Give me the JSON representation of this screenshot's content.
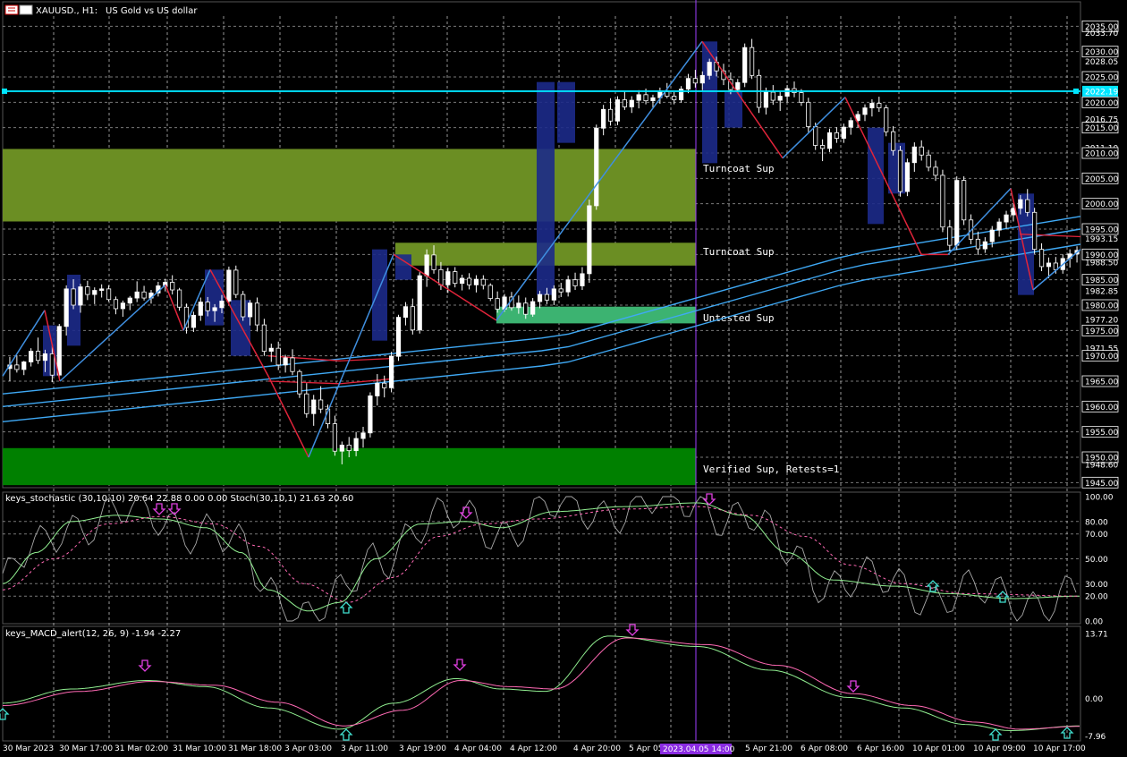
{
  "header": {
    "symbol": "XAUUSD., H1:",
    "description": "US Gold vs US dollar"
  },
  "colors": {
    "background": "#000000",
    "grid": "#c8c8c8",
    "bull_candle": "#ffffff",
    "bear_candle": "#000000",
    "ema_blue": "#3fa9f5",
    "ema_red": "#e0243a",
    "zigzag_up": "#3f8fe0",
    "zigzag_down": "#e0243a",
    "hline": "#00e5ff",
    "zone_turncoat": "#6b8e23",
    "zone_untested": "#3cb371",
    "zone_verified": "#008000",
    "signal_down": "#e040e0",
    "signal_up": "#40e0d0",
    "vline": "#a040ff",
    "stoch_main": "#a9a9a9",
    "stoch_signal": "#90ee90",
    "stoch_dash": "#ff69b4",
    "macd_main": "#90ee90",
    "macd_signal": "#ff69b4"
  },
  "price_axis": {
    "labels": [
      "2035.00",
      "2033.70",
      "2030.00",
      "2028.05",
      "2025.00",
      "2022.19",
      "2020.00",
      "2016.75",
      "2015.00",
      "2011.10",
      "2010.00",
      "2005.00",
      "2000.00",
      "1995.00",
      "1993.15",
      "1990.00",
      "1988.50",
      "1985.00",
      "1982.85",
      "1980.00",
      "1977.20",
      "1975.00",
      "1971.55",
      "1970.00",
      "1965.00",
      "1960.00",
      "1955.00",
      "1950.00",
      "1948.60",
      "1945.00"
    ],
    "current_price": "2022.19"
  },
  "zones": [
    {
      "label": "Turncoat Sup",
      "top": 2010.8,
      "bottom": 1996.5,
      "kind": "turncoat"
    },
    {
      "label": "Turncoat Sup",
      "top": 1992.3,
      "bottom": 1987.8,
      "kind": "turncoat"
    },
    {
      "label": "Untested Sup",
      "top": 1979.7,
      "bottom": 1976.4,
      "kind": "untested"
    },
    {
      "label": "Verified Sup, Retests=1",
      "top": 1951.8,
      "bottom": 1944.5,
      "kind": "verified"
    }
  ],
  "stochastic": {
    "title": "keys_stochastic (30,10,10) 20.64 22.88 0.00 0.00 Stoch(30,10,1) 21.63 20.60",
    "levels": [
      "100.00",
      "80.00",
      "70.00",
      "50.00",
      "30.00",
      "20.00",
      "0.00"
    ]
  },
  "macd": {
    "title": "keys_MACD_alert(12, 26, 9) -1.94 -2.27",
    "levels": [
      "13.71",
      "0.00",
      "-7.96"
    ]
  },
  "time_axis": {
    "labels": [
      "30 Mar 2023",
      "30 Mar 17:00",
      "31 Mar 02:00",
      "31 Mar 10:00",
      "31 Mar 18:00",
      "3 Apr 03:00",
      "3 Apr 11:00",
      "3 Apr 19:00",
      "4 Apr 04:00",
      "4 Apr 12:00",
      "4 Apr 20:00",
      "5 Apr 05:00",
      "5 Apr 21:00",
      "6 Apr 08:00",
      "6 Apr 16:00",
      "10 Apr 01:00",
      "10 Apr 09:00",
      "10 Apr 17:00"
    ],
    "cursor_label": "2023.04.05 14:00"
  },
  "chart_data": {
    "type": "candlestick",
    "title": "",
    "symbol": "XAUUSD.",
    "timeframe": "H1",
    "ylim": [
      1944,
      2037
    ],
    "candles": [
      [
        1967.5,
        1969.8,
        1965.0,
        1968.2
      ],
      [
        1968.2,
        1970.1,
        1966.7,
        1967.3
      ],
      [
        1967.3,
        1969.0,
        1966.2,
        1968.8
      ],
      [
        1968.8,
        1971.5,
        1967.9,
        1970.9
      ],
      [
        1970.9,
        1973.6,
        1968.4,
        1969.1
      ],
      [
        1969.1,
        1971.2,
        1966.8,
        1970.4
      ],
      [
        1970.4,
        1972.0,
        1964.8,
        1966.2
      ],
      [
        1966.2,
        1976.3,
        1965.7,
        1975.8
      ],
      [
        1975.8,
        1983.9,
        1974.0,
        1983.2
      ],
      [
        1983.2,
        1985.1,
        1979.2,
        1980.0
      ],
      [
        1980.0,
        1984.2,
        1978.5,
        1983.6
      ],
      [
        1983.6,
        1984.8,
        1981.0,
        1982.1
      ],
      [
        1982.1,
        1983.5,
        1980.2,
        1982.9
      ],
      [
        1982.9,
        1984.1,
        1981.5,
        1983.2
      ],
      [
        1983.2,
        1983.9,
        1980.7,
        1981.1
      ],
      [
        1981.1,
        1981.7,
        1978.2,
        1979.3
      ],
      [
        1979.3,
        1980.9,
        1977.7,
        1980.4
      ],
      [
        1980.4,
        1981.8,
        1979.0,
        1981.4
      ],
      [
        1981.4,
        1984.7,
        1980.6,
        1982.6
      ],
      [
        1982.6,
        1983.8,
        1980.9,
        1981.4
      ],
      [
        1981.4,
        1983.0,
        1980.3,
        1982.4
      ],
      [
        1982.4,
        1984.6,
        1981.7,
        1983.8
      ],
      [
        1983.8,
        1985.2,
        1982.7,
        1984.5
      ],
      [
        1984.5,
        1985.9,
        1982.1,
        1983.0
      ],
      [
        1983.0,
        1983.4,
        1978.9,
        1979.6
      ],
      [
        1979.6,
        1980.3,
        1974.4,
        1975.6
      ],
      [
        1975.6,
        1978.7,
        1974.7,
        1978.0
      ],
      [
        1978.0,
        1981.5,
        1976.9,
        1980.6
      ],
      [
        1980.6,
        1981.6,
        1977.8,
        1978.9
      ],
      [
        1978.9,
        1980.2,
        1976.7,
        1979.5
      ],
      [
        1979.5,
        1982.0,
        1978.4,
        1980.8
      ],
      [
        1980.8,
        1987.6,
        1979.9,
        1986.9
      ],
      [
        1986.9,
        1987.8,
        1981.4,
        1982.1
      ],
      [
        1982.1,
        1982.8,
        1976.9,
        1977.7
      ],
      [
        1977.7,
        1981.0,
        1976.0,
        1980.4
      ],
      [
        1980.4,
        1981.5,
        1974.8,
        1976.1
      ],
      [
        1976.1,
        1977.3,
        1970.0,
        1970.9
      ],
      [
        1970.9,
        1972.4,
        1968.8,
        1971.5
      ],
      [
        1971.5,
        1972.8,
        1967.2,
        1968.2
      ],
      [
        1968.2,
        1970.2,
        1966.7,
        1969.6
      ],
      [
        1969.6,
        1971.3,
        1966.2,
        1966.9
      ],
      [
        1966.9,
        1967.3,
        1961.7,
        1962.5
      ],
      [
        1962.5,
        1964.6,
        1957.8,
        1958.6
      ],
      [
        1958.6,
        1962.3,
        1956.2,
        1961.3
      ],
      [
        1961.3,
        1964.0,
        1958.7,
        1959.5
      ],
      [
        1959.5,
        1960.4,
        1955.7,
        1956.6
      ],
      [
        1956.6,
        1958.2,
        1950.3,
        1951.2
      ],
      [
        1951.2,
        1953.1,
        1948.6,
        1952.4
      ],
      [
        1952.4,
        1954.0,
        1950.0,
        1951.3
      ],
      [
        1951.3,
        1955.0,
        1950.2,
        1953.7
      ],
      [
        1953.7,
        1956.0,
        1951.9,
        1954.8
      ],
      [
        1954.8,
        1962.8,
        1953.9,
        1962.1
      ],
      [
        1962.1,
        1966.4,
        1960.2,
        1964.6
      ],
      [
        1964.6,
        1966.1,
        1961.8,
        1963.7
      ],
      [
        1963.7,
        1970.8,
        1962.8,
        1969.9
      ],
      [
        1969.9,
        1978.1,
        1969.0,
        1977.6
      ],
      [
        1977.6,
        1980.6,
        1976.0,
        1979.7
      ],
      [
        1979.7,
        1981.3,
        1974.2,
        1975.1
      ],
      [
        1975.1,
        1986.5,
        1974.4,
        1985.8
      ],
      [
        1985.8,
        1991.0,
        1983.6,
        1989.9
      ],
      [
        1989.9,
        1991.8,
        1986.2,
        1987.0
      ],
      [
        1987.0,
        1988.5,
        1983.0,
        1984.0
      ],
      [
        1984.0,
        1987.4,
        1982.4,
        1986.6
      ],
      [
        1986.6,
        1987.5,
        1983.5,
        1984.3
      ],
      [
        1984.3,
        1986.0,
        1982.9,
        1985.3
      ],
      [
        1985.3,
        1986.3,
        1983.1,
        1984.0
      ],
      [
        1984.0,
        1985.9,
        1982.5,
        1985.1
      ],
      [
        1985.1,
        1985.9,
        1983.1,
        1983.9
      ],
      [
        1983.9,
        1984.3,
        1980.8,
        1981.3
      ],
      [
        1981.3,
        1982.7,
        1978.5,
        1979.2
      ],
      [
        1979.2,
        1982.2,
        1978.7,
        1981.6
      ],
      [
        1981.6,
        1982.6,
        1978.9,
        1979.5
      ],
      [
        1979.5,
        1981.9,
        1978.3,
        1980.4
      ],
      [
        1980.4,
        1981.5,
        1977.3,
        1978.2
      ],
      [
        1978.2,
        1981.4,
        1977.7,
        1980.7
      ],
      [
        1980.7,
        1982.8,
        1979.4,
        1982.1
      ],
      [
        1982.1,
        1983.4,
        1980.2,
        1981.0
      ],
      [
        1981.0,
        1983.9,
        1980.0,
        1983.2
      ],
      [
        1983.2,
        1984.4,
        1981.6,
        1982.6
      ],
      [
        1982.6,
        1985.8,
        1981.7,
        1985.0
      ],
      [
        1985.0,
        1986.4,
        1983.0,
        1983.8
      ],
      [
        1983.8,
        1987.5,
        1983.0,
        1986.2
      ],
      [
        1986.2,
        2000.8,
        1984.4,
        1999.6
      ],
      [
        1999.6,
        2015.6,
        1998.8,
        2014.9
      ],
      [
        2014.9,
        2019.5,
        2013.5,
        2018.6
      ],
      [
        2018.6,
        2020.8,
        2015.4,
        2016.3
      ],
      [
        2016.3,
        2021.2,
        2015.5,
        2020.5
      ],
      [
        2020.5,
        2022.3,
        2018.5,
        2019.1
      ],
      [
        2019.1,
        2021.2,
        2017.9,
        2020.4
      ],
      [
        2020.4,
        2022.4,
        2018.8,
        2021.5
      ],
      [
        2021.5,
        2022.7,
        2019.6,
        2020.3
      ],
      [
        2020.3,
        2021.5,
        2019.0,
        2020.9
      ],
      [
        2020.9,
        2022.9,
        2019.7,
        2022.1
      ],
      [
        2022.1,
        2023.8,
        2020.8,
        2021.2
      ],
      [
        2021.2,
        2022.0,
        2019.6,
        2020.5
      ],
      [
        2020.5,
        2023.2,
        2019.9,
        2022.6
      ],
      [
        2022.6,
        2025.6,
        2021.8,
        2024.7
      ],
      [
        2024.7,
        2026.4,
        2022.9,
        2023.8
      ],
      [
        2023.8,
        2026.1,
        2022.4,
        2025.3
      ],
      [
        2025.3,
        2028.6,
        2024.5,
        2027.9
      ],
      [
        2027.9,
        2029.0,
        2025.1,
        2026.2
      ],
      [
        2026.2,
        2027.6,
        2023.4,
        2024.5
      ],
      [
        2024.5,
        2025.9,
        2021.6,
        2022.5
      ],
      [
        2022.5,
        2024.6,
        2021.8,
        2023.9
      ],
      [
        2023.9,
        2031.6,
        2023.0,
        2030.8
      ],
      [
        2030.8,
        2032.5,
        2024.6,
        2025.3
      ],
      [
        2025.3,
        2026.5,
        2017.9,
        2019.0
      ],
      [
        2019.0,
        2022.9,
        2017.6,
        2022.0
      ],
      [
        2022.0,
        2023.4,
        2019.5,
        2020.4
      ],
      [
        2020.4,
        2022.1,
        2018.3,
        2021.2
      ],
      [
        2021.2,
        2023.4,
        2020.0,
        2022.7
      ],
      [
        2022.7,
        2024.1,
        2021.0,
        2021.9
      ],
      [
        2021.9,
        2022.6,
        2019.3,
        2020.0
      ],
      [
        2020.0,
        2020.9,
        2014.1,
        2015.2
      ],
      [
        2015.2,
        2016.0,
        2010.6,
        2011.5
      ],
      [
        2011.5,
        2012.7,
        2008.4,
        2010.9
      ],
      [
        2010.9,
        2014.8,
        2010.2,
        2014.0
      ],
      [
        2014.0,
        2015.1,
        2012.0,
        2012.9
      ],
      [
        2012.9,
        2015.8,
        2012.0,
        2015.1
      ],
      [
        2015.1,
        2017.0,
        2013.6,
        2016.4
      ],
      [
        2016.4,
        2018.3,
        2015.0,
        2017.6
      ],
      [
        2017.6,
        2019.6,
        2016.3,
        2018.9
      ],
      [
        2018.9,
        2020.6,
        2017.2,
        2019.8
      ],
      [
        2019.8,
        2021.1,
        2018.1,
        2018.9
      ],
      [
        2018.9,
        2019.5,
        2013.3,
        2014.2
      ],
      [
        2014.2,
        2015.3,
        2009.5,
        2010.5
      ],
      [
        2010.5,
        2011.4,
        2001.4,
        2002.4
      ],
      [
        2002.4,
        2008.9,
        2001.5,
        2008.1
      ],
      [
        2008.1,
        2012.1,
        2006.3,
        2011.2
      ],
      [
        2011.2,
        2012.5,
        2008.5,
        2009.6
      ],
      [
        2009.6,
        2010.6,
        2006.4,
        2007.2
      ],
      [
        2007.2,
        2008.5,
        2004.5,
        2005.6
      ],
      [
        2005.6,
        2006.7,
        1994.4,
        1995.4
      ],
      [
        1995.4,
        1996.8,
        1990.6,
        1991.8
      ],
      [
        1991.8,
        2005.4,
        1990.9,
        2004.6
      ],
      [
        2004.6,
        2005.4,
        1995.8,
        1996.8
      ],
      [
        1996.8,
        1997.9,
        1992.0,
        1993.0
      ],
      [
        1993.0,
        1994.5,
        1989.9,
        1991.1
      ],
      [
        1991.1,
        1993.4,
        1990.3,
        1992.5
      ],
      [
        1992.5,
        1995.6,
        1991.4,
        1994.8
      ],
      [
        1994.8,
        1997.1,
        1993.5,
        1996.4
      ],
      [
        1996.4,
        1998.6,
        1995.1,
        1997.8
      ],
      [
        1997.8,
        2000.0,
        1996.5,
        1999.1
      ],
      [
        1999.1,
        2001.7,
        1997.9,
        2000.8
      ],
      [
        2000.8,
        2002.9,
        1997.5,
        1998.3
      ],
      [
        1998.3,
        1999.2,
        1990.1,
        1991.0
      ],
      [
        1991.0,
        1992.2,
        1986.7,
        1987.6
      ],
      [
        1987.6,
        1989.4,
        1985.3,
        1988.3
      ],
      [
        1988.3,
        1989.5,
        1986.2,
        1987.0
      ],
      [
        1987.0,
        1990.0,
        1986.2,
        1989.2
      ],
      [
        1989.2,
        1991.0,
        1987.4,
        1990.1
      ],
      [
        1990.1,
        1991.6,
        1988.4,
        1990.8
      ]
    ],
    "ema_levels_end": [
      1993.15,
      1990.0,
      1988.5
    ]
  }
}
